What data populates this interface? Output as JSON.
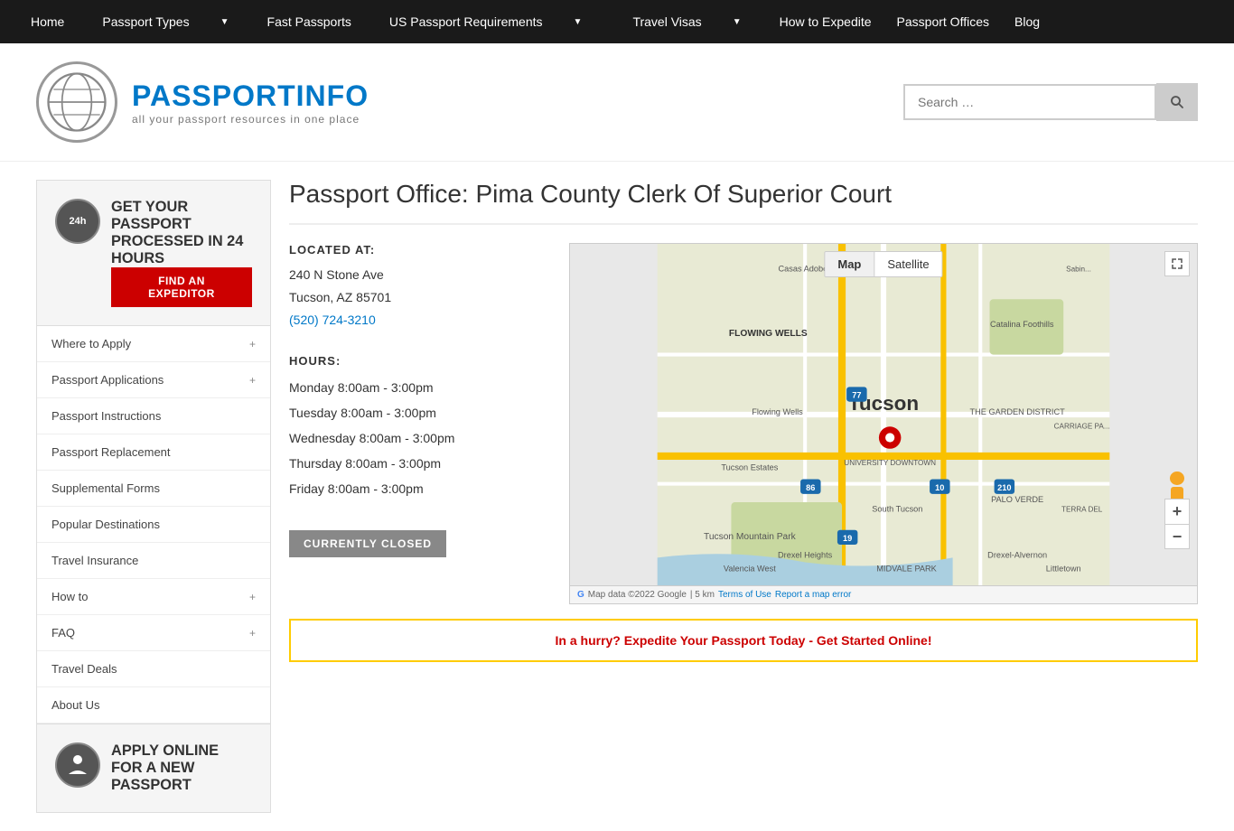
{
  "topnav": {
    "items": [
      {
        "label": "Home",
        "hasDropdown": false
      },
      {
        "label": "Passport Types",
        "hasDropdown": true
      },
      {
        "label": "Fast Passports",
        "hasDropdown": false
      },
      {
        "label": "US Passport Requirements",
        "hasDropdown": true
      },
      {
        "label": "Travel Visas",
        "hasDropdown": true
      },
      {
        "label": "How to Expedite",
        "hasDropdown": false
      },
      {
        "label": "Passport Offices",
        "hasDropdown": false
      },
      {
        "label": "Blog",
        "hasDropdown": false
      }
    ]
  },
  "header": {
    "logo_text_plain": "PASSPORT",
    "logo_text_accent": "INFO",
    "tagline": "all your passport resources in one place",
    "search_placeholder": "Search …"
  },
  "sidebar": {
    "promo": {
      "icon_text": "24h",
      "heading": "GET YOUR PASSPORT PROCESSED IN 24 HOURS",
      "button_label": "FIND AN EXPEDITOR"
    },
    "nav_items": [
      {
        "label": "Where to Apply",
        "hasExpand": true
      },
      {
        "label": "Passport Applications",
        "hasExpand": true
      },
      {
        "label": "Passport Instructions",
        "hasExpand": false
      },
      {
        "label": "Passport Replacement",
        "hasExpand": false
      },
      {
        "label": "Supplemental Forms",
        "hasExpand": false
      },
      {
        "label": "Popular Destinations",
        "hasExpand": false
      },
      {
        "label": "Travel Insurance",
        "hasExpand": false
      },
      {
        "label": "How to",
        "hasExpand": true
      },
      {
        "label": "FAQ",
        "hasExpand": true
      },
      {
        "label": "Travel Deals",
        "hasExpand": false
      },
      {
        "label": "About Us",
        "hasExpand": false
      }
    ],
    "promo2": {
      "heading": "APPLY ONLINE FOR A NEW PASSPORT"
    }
  },
  "content": {
    "page_title": "Passport Office: Pima County Clerk Of Superior Court",
    "location_label": "LOCATED AT:",
    "address_line1": "240 N Stone Ave",
    "address_line2": "Tucson, AZ 85701",
    "phone": "(520) 724-3210",
    "hours_label": "HOURS:",
    "hours": [
      {
        "day": "Monday",
        "hours": "8:00am - 3:00pm"
      },
      {
        "day": "Tuesday",
        "hours": "8:00am - 3:00pm"
      },
      {
        "day": "Wednesday",
        "hours": "8:00am - 3:00pm"
      },
      {
        "day": "Thursday",
        "hours": "8:00am - 3:00pm"
      },
      {
        "day": "Friday",
        "hours": "8:00am - 3:00pm"
      }
    ],
    "status": "CURRENTLY CLOSED",
    "map_tab_map": "Map",
    "map_tab_satellite": "Satellite",
    "map_city": "Tucson",
    "map_footer_data": "Map data ©2022 Google",
    "map_footer_scale": "5 km",
    "map_footer_terms": "Terms of Use",
    "map_footer_report": "Report a map error",
    "cta_text": "In a hurry? Expedite Your Passport Today - Get Started Online!"
  }
}
